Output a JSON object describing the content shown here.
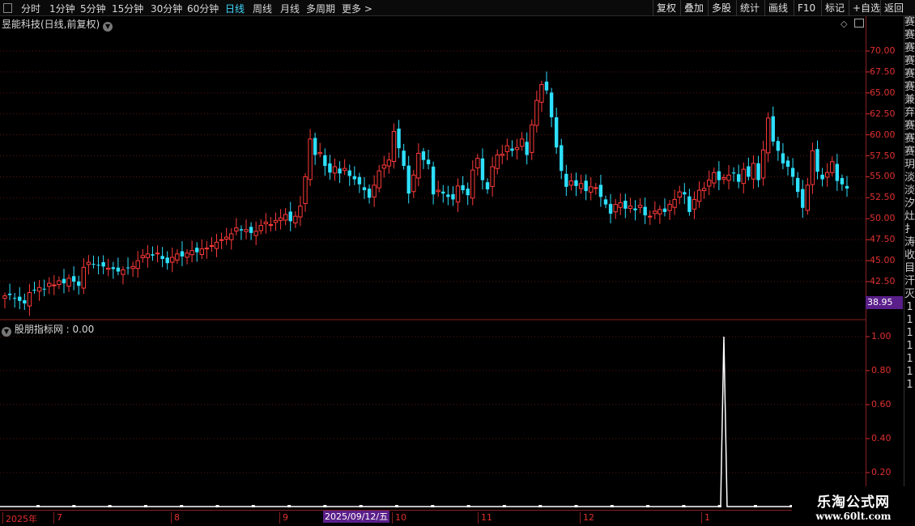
{
  "periods": [
    {
      "label": "分时"
    },
    {
      "label": "1分钟"
    },
    {
      "label": "5分钟"
    },
    {
      "label": "15分钟"
    },
    {
      "label": "30分钟"
    },
    {
      "label": "60分钟"
    },
    {
      "label": "日线",
      "active": true
    },
    {
      "label": "周线"
    },
    {
      "label": "月线"
    },
    {
      "label": "多周期"
    },
    {
      "label": "更多"
    }
  ],
  "toolbar": [
    "复权",
    "叠加",
    "多股",
    "统计",
    "画线",
    "F10",
    "标记",
    "+自选",
    "返回"
  ],
  "main_title": "昱能科技(日线,前复权)",
  "indicator_title": "股朋指标网 : 0.00",
  "current_price_flag": "38.95",
  "cursor_date": "2025/09/12/五",
  "date_axis": [
    "2025年",
    "7",
    "8",
    "9",
    "10",
    "11",
    "12",
    "1"
  ],
  "side_strip": [
    "赛",
    "赛",
    "赛",
    "赛",
    "赛",
    "赛",
    "兼",
    "弃",
    "赛",
    "赛",
    "赛",
    "玥",
    "淡",
    "淡",
    "汐",
    "灶",
    "扌",
    "涛",
    "收",
    "目",
    "汗",
    "灭",
    "1",
    "1",
    "1",
    "1",
    "1",
    "1",
    "1"
  ],
  "watermark": {
    "line1": "乐淘公式网",
    "line2": "www.60lt.com"
  },
  "colors": {
    "up": "#ff3a3a",
    "down": "#2de0ff",
    "grid": "#5a1414",
    "axis": "#e03030"
  },
  "chart_data": [
    {
      "type": "candlestick",
      "title": "昱能科技(日线,前复权)",
      "y_ticks": [
        "70.00",
        "67.50",
        "65.00",
        "62.50",
        "60.00",
        "57.50",
        "55.00",
        "52.50",
        "50.00",
        "47.50",
        "45.00",
        "42.50"
      ],
      "ylim": [
        38.95,
        72.0
      ],
      "close": [
        40.8,
        40.9,
        40.5,
        40.2,
        39.9,
        41.2,
        41.5,
        41.8,
        41.6,
        42.3,
        42.1,
        42.6,
        42.3,
        42.9,
        42.5,
        42.0,
        44.2,
        44.8,
        44.6,
        44.5,
        44.3,
        44.1,
        44.0,
        43.7,
        43.9,
        44.1,
        44.3,
        45.0,
        45.6,
        45.8,
        45.6,
        45.9,
        45.2,
        44.7,
        45.4,
        45.8,
        45.5,
        45.9,
        46.2,
        46.0,
        46.4,
        46.5,
        46.8,
        47.2,
        47.5,
        47.8,
        48.2,
        48.9,
        48.6,
        48.7,
        48.3,
        48.5,
        49.2,
        49.6,
        49.3,
        49.8,
        50.1,
        50.5,
        49.7,
        50.3,
        51.5,
        55.0,
        59.5,
        57.6,
        57.9,
        56.3,
        55.5,
        56.2,
        55.4,
        56.0,
        55.1,
        54.7,
        54.1,
        53.4,
        52.5,
        54.0,
        55.7,
        56.4,
        57.0,
        60.4,
        58.4,
        56.3,
        53.0,
        55.2,
        57.8,
        57.0,
        56.5,
        52.9,
        53.4,
        53.0,
        52.6,
        52.3,
        53.9,
        53.4,
        52.8,
        55.8,
        57.2,
        54.6,
        53.5,
        56.2,
        57.6,
        57.7,
        58.7,
        58.1,
        58.5,
        59.5,
        57.6,
        61.2,
        64.1,
        66.0,
        65.3,
        62.1,
        58.5,
        55.7,
        53.8,
        54.5,
        53.9,
        54.2,
        53.3,
        53.8,
        53.7,
        52.6,
        51.7,
        50.6,
        51.7,
        51.9,
        51.2,
        51.5,
        51.0,
        51.6,
        50.4,
        50.3,
        50.9,
        51.1,
        50.8,
        51.7,
        52.3,
        53.2,
        52.9,
        50.8,
        52.3,
        53.4,
        53.6,
        54.6,
        55.5,
        54.6,
        54.9,
        55.2,
        55.4,
        54.4,
        55.9,
        55.0,
        56.6,
        54.6,
        58.2,
        62.0,
        59.2,
        58.1,
        56.6,
        56.2,
        55.0,
        53.2,
        51.3,
        54.0,
        58.1,
        55.6,
        54.7,
        55.5,
        56.8,
        54.5,
        54.1,
        53.6
      ]
    },
    {
      "type": "line",
      "title": "股朋指标网",
      "y_ticks": [
        "1.00",
        "0.80",
        "0.60",
        "0.40",
        "0.20"
      ],
      "ylim": [
        0,
        1.0
      ],
      "spike_index": 146,
      "spike_value": 1.0,
      "baseline": 0.0
    }
  ]
}
